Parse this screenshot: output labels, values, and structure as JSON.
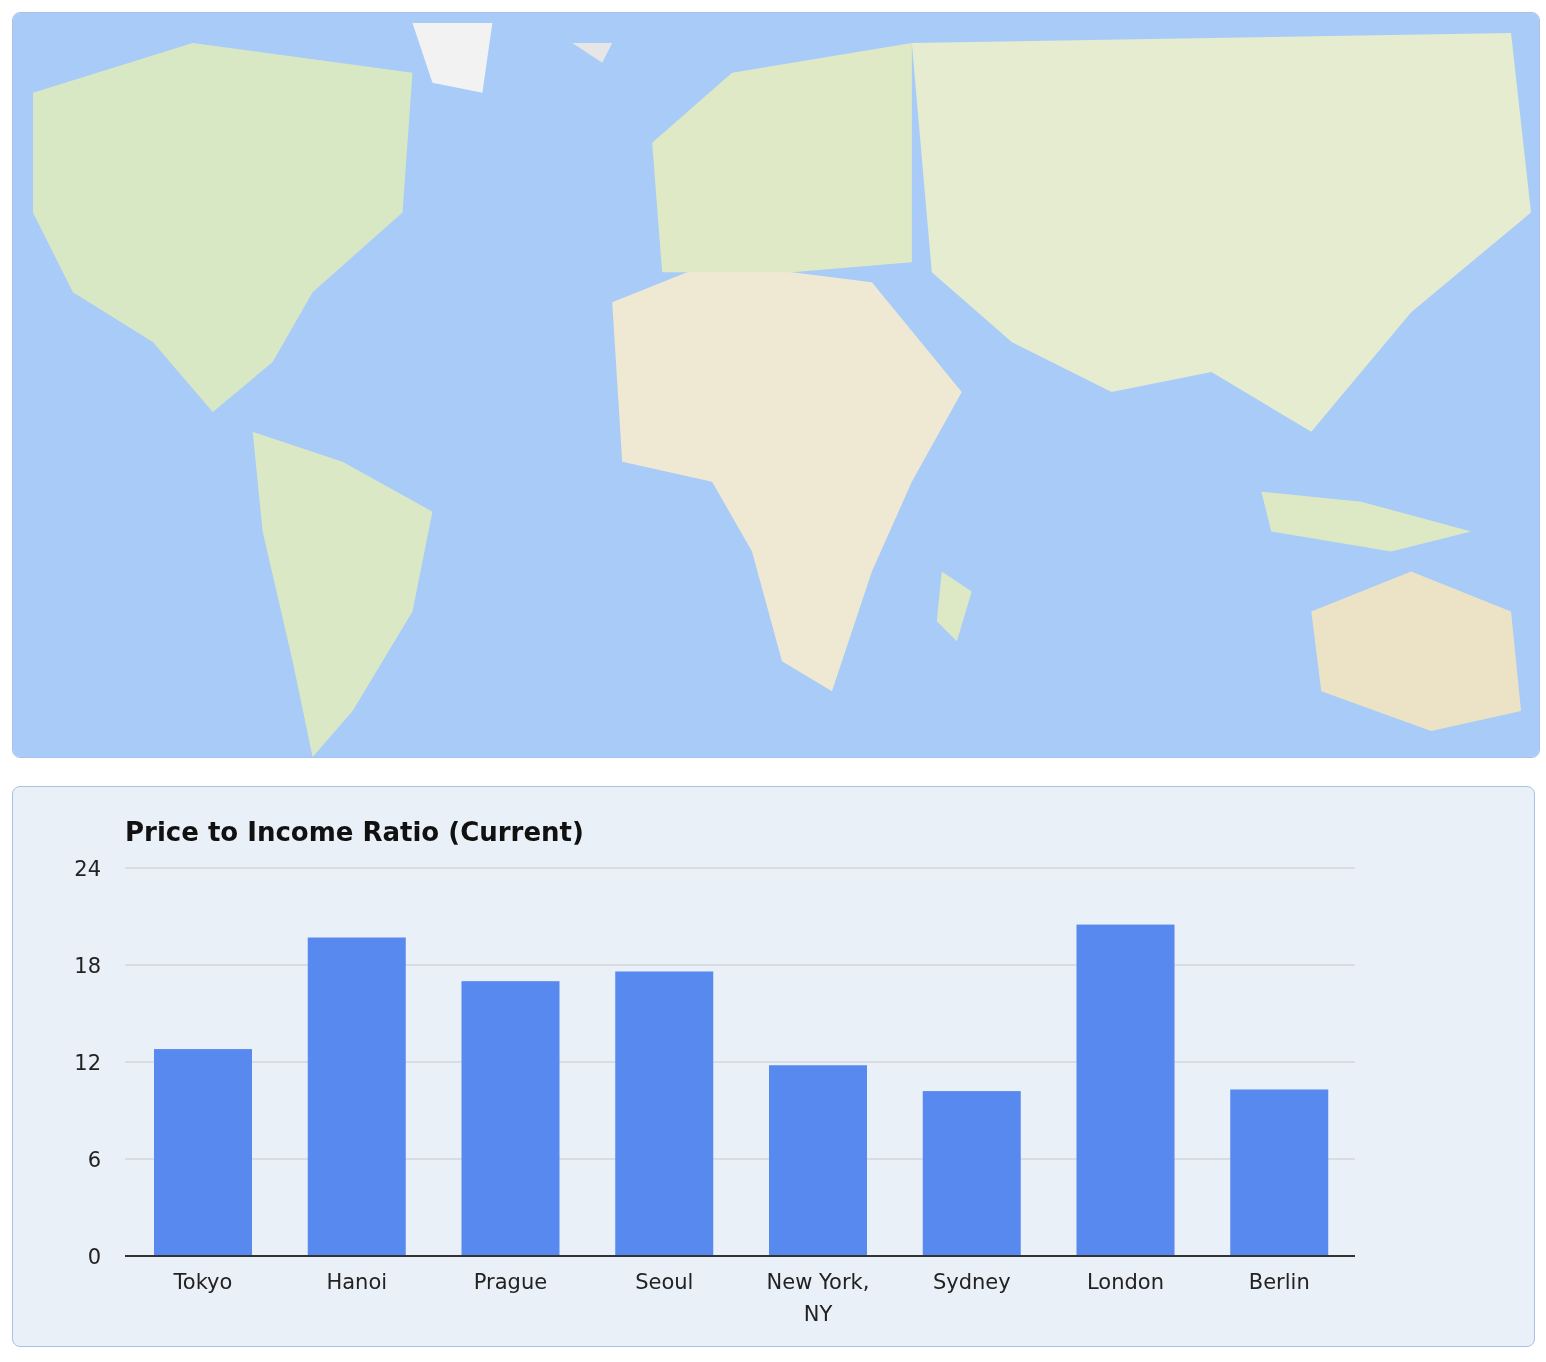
{
  "chart": {
    "chart_data": {
      "type": "bar",
      "title": "Price to Income Ratio (Current)",
      "categories": [
        "Tokyo",
        "Hanoi",
        "Prague",
        "Seoul",
        "New York, NY",
        "Sydney",
        "London",
        "Berlin"
      ],
      "series": [
        {
          "color": "#5789ee",
          "values": [
            12.8,
            19.7,
            17.0,
            17.6,
            11.8,
            10.2,
            20.5,
            10.3
          ]
        }
      ],
      "ylim": [
        0,
        24
      ],
      "yticks": [
        0,
        6,
        12,
        18,
        24
      ],
      "grid": true
    }
  }
}
